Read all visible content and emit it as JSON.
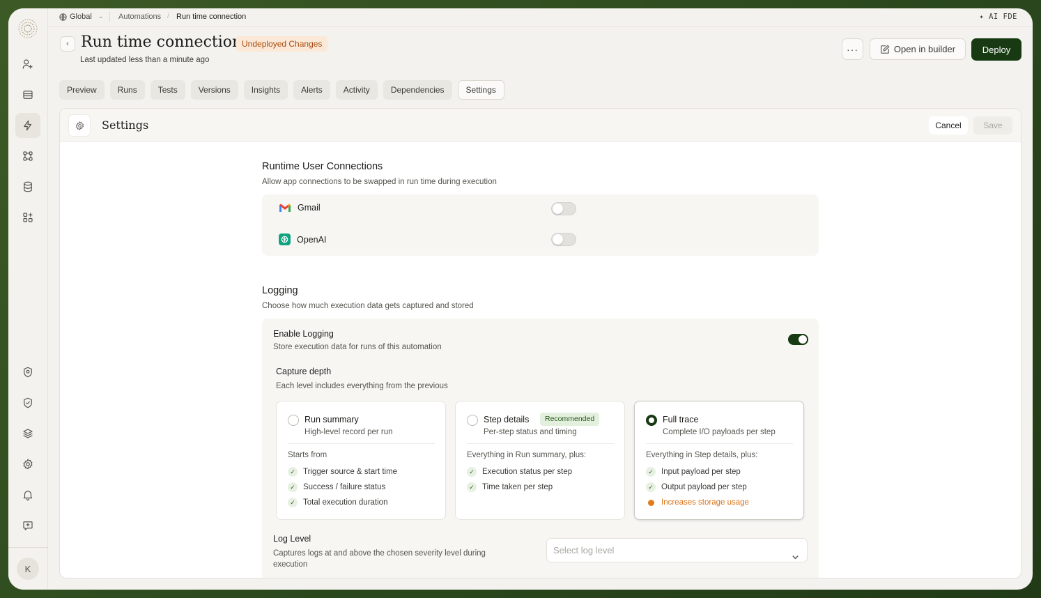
{
  "topbar": {
    "workspace": "Global",
    "breadcrumb_parent": "Automations",
    "breadcrumb_current": "Run time connection",
    "ai_label": "✦ AI FDE"
  },
  "header": {
    "title": "Run time connection",
    "status_badge": "Undeployed Changes",
    "updated": "Last updated less than a minute ago",
    "more_label": "···",
    "open_builder": "Open in builder",
    "deploy": "Deploy"
  },
  "tabs": [
    {
      "label": "Preview"
    },
    {
      "label": "Runs"
    },
    {
      "label": "Tests"
    },
    {
      "label": "Versions"
    },
    {
      "label": "Insights"
    },
    {
      "label": "Alerts"
    },
    {
      "label": "Activity"
    },
    {
      "label": "Dependencies"
    },
    {
      "label": "Settings",
      "active": true
    }
  ],
  "panel": {
    "title": "Settings",
    "cancel": "Cancel",
    "save": "Save"
  },
  "runtime": {
    "title": "Runtime User Connections",
    "subtitle": "Allow app connections to be swapped in run time during execution",
    "connections": [
      {
        "name": "Gmail",
        "icon": "gmail-icon",
        "enabled": false
      },
      {
        "name": "OpenAI",
        "icon": "openai-icon",
        "enabled": false
      }
    ]
  },
  "logging": {
    "title": "Logging",
    "subtitle": "Choose how much execution data gets captured and stored",
    "enable_title": "Enable Logging",
    "enable_sub": "Store execution data for runs of this automation",
    "enabled": true,
    "capture_title": "Capture depth",
    "capture_sub": "Each level includes everything from the previous",
    "levels": [
      {
        "name": "Run summary",
        "desc": "High-level record per run",
        "from": "Starts from",
        "features": [
          "Trigger source & start time",
          "Success / failure status",
          "Total execution duration"
        ],
        "selected": false
      },
      {
        "name": "Step details",
        "badge": "Recommended",
        "desc": "Per-step status and timing",
        "from": "Everything in Run summary, plus:",
        "features": [
          "Execution status per step",
          "Time taken per step"
        ],
        "selected": false
      },
      {
        "name": "Full trace",
        "desc": "Complete I/O payloads per step",
        "from": "Everything in Step details, plus:",
        "features": [
          "Input payload per step",
          "Output payload per step"
        ],
        "warning": "Increases storage usage",
        "selected": true
      }
    ],
    "log_level_title": "Log Level",
    "log_level_sub": "Captures logs at and above the chosen severity level during execution",
    "log_level_placeholder": "Select log level"
  },
  "user": {
    "initial": "K"
  },
  "colors": {
    "accent": "#173a12",
    "badge_bg": "#fbe8d6",
    "badge_text": "#a84d12",
    "warning": "#e37b1c"
  }
}
